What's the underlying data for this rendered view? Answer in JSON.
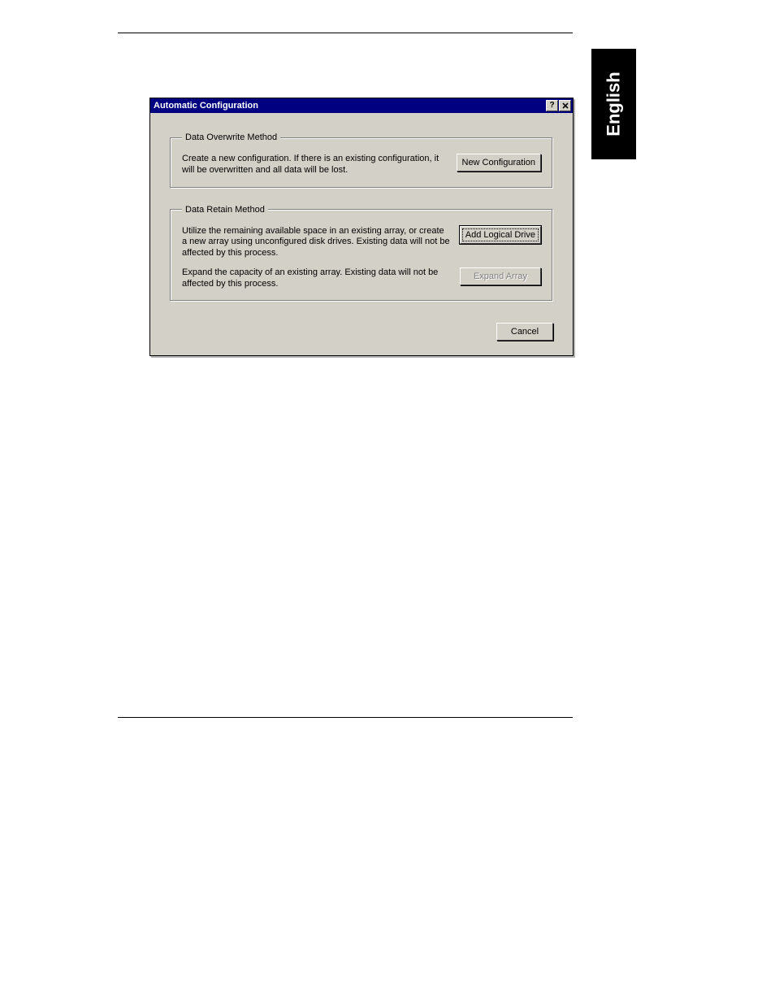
{
  "page": {
    "side_tab": "English"
  },
  "dialog": {
    "title": "Automatic Configuration",
    "titlebar_help_icon": "help-icon",
    "titlebar_close_icon": "close-icon",
    "groups": {
      "overwrite": {
        "legend": "Data Overwrite Method",
        "items": {
          "new_config": {
            "desc": "Create a new configuration. If there is an existing configuration, it will be overwritten and all data will be lost.",
            "button": "New Configuration"
          }
        }
      },
      "retain": {
        "legend": "Data Retain Method",
        "items": {
          "add_logical": {
            "desc": "Utilize the remaining available space in an existing array, or create a new array using unconfigured disk drives. Existing data will not be affected by this process.",
            "button": "Add Logical Drive"
          },
          "expand": {
            "desc": "Expand the capacity of an existing array. Existing data will not be affected by this process.",
            "button": "Expand Array"
          }
        }
      }
    },
    "footer": {
      "cancel": "Cancel"
    }
  }
}
